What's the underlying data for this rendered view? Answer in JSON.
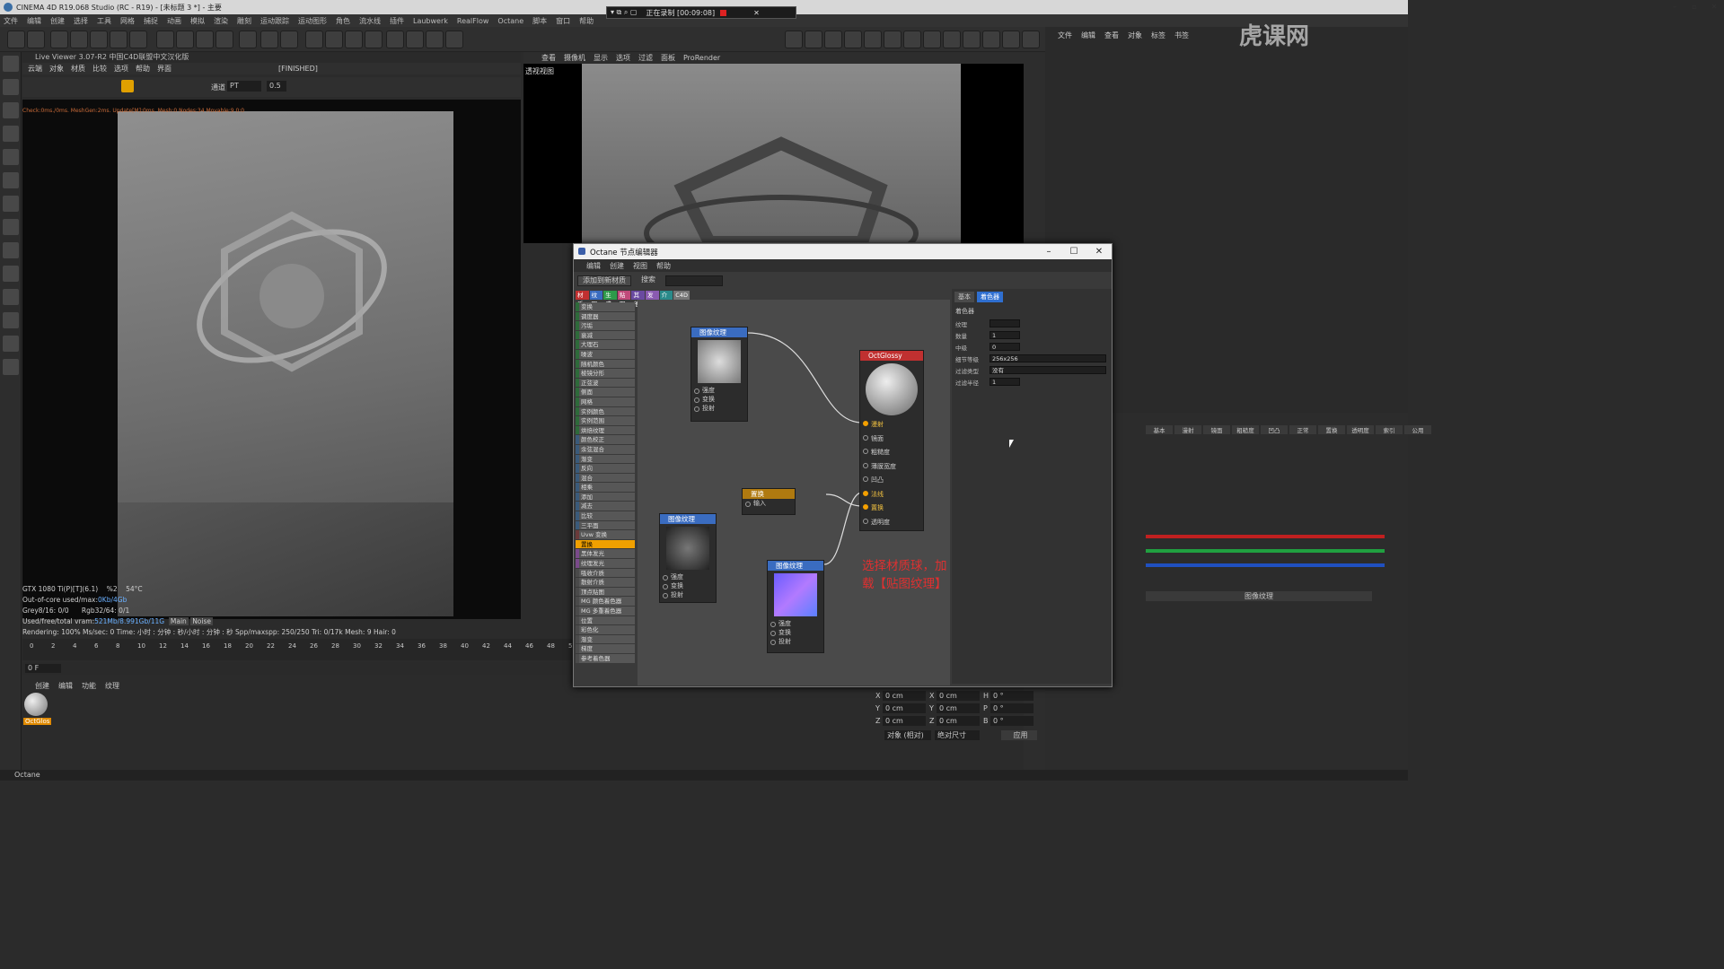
{
  "window": {
    "title": "CINEMA 4D R19.068 Studio (RC - R19) - [未标题 3 *] - 主要"
  },
  "menubar": [
    "文件",
    "编辑",
    "创建",
    "选择",
    "工具",
    "网格",
    "捕捉",
    "动画",
    "模拟",
    "渲染",
    "雕刻",
    "运动跟踪",
    "运动图形",
    "角色",
    "流水线",
    "插件",
    "Laubwerk",
    "RealFlow",
    "Octane",
    "脚本",
    "窗口",
    "帮助"
  ],
  "recorder": {
    "label": "正在录制 [00:09:08]"
  },
  "live_viewer": {
    "title": "Live Viewer 3.07-R2 中国C4D联盟中文汉化版",
    "menu": [
      "云端",
      "对象",
      "材质",
      "比较",
      "选项",
      "帮助",
      "界面"
    ],
    "state": "[FINISHED]",
    "channel_label": "通道",
    "channel_value": "PT",
    "channel_num": "0.5",
    "status_line": "Check:0ms./0ms. MeshGen:2ms. Update[M]:0ms. Mesh:0 Nodes:34 Movable:9  0:0",
    "stats": {
      "gpu": "GTX 1080 Ti(P)[T](6.1)",
      "gpu_pct": "%2",
      "gpu_temp": "54°C",
      "ooc": "Out-of-core used/max:",
      "ooc_val": "0Kb/4Gb",
      "grey": "Grey8/16: 0/0",
      "rgb": "Rgb32/64: 0/1",
      "vram": "Used/free/total vram:",
      "vram_val": "521Mb/8.991Gb/11G",
      "tab_main": "Main",
      "tab_noise": "Noise",
      "render_line": "Rendering: 100%   Ms/sec: 0   Time: 小时 : 分钟 : 秒/小时 : 分钟 : 秒   Spp/maxspp: 250/250   Tri: 0/17k   Mesh: 9   Hair: 0"
    }
  },
  "timeline": {
    "ticks": [
      "0",
      "2",
      "4",
      "6",
      "8",
      "10",
      "12",
      "14",
      "16",
      "18",
      "20",
      "22",
      "24",
      "26",
      "28",
      "30",
      "32",
      "34",
      "36",
      "38",
      "40",
      "42",
      "44",
      "46",
      "48",
      "50"
    ],
    "frame": "0 F"
  },
  "material_manager": {
    "menu": [
      "创建",
      "编辑",
      "功能",
      "纹理"
    ],
    "material_name": "OctGlos"
  },
  "viewport": {
    "menu": [
      "查看",
      "摄像机",
      "显示",
      "选项",
      "过滤",
      "面板",
      "ProRender"
    ],
    "label": "透视视图"
  },
  "object_manager": {
    "menu": [
      "文件",
      "编辑",
      "查看",
      "对象",
      "标签",
      "书签"
    ]
  },
  "octane_dialog": {
    "title": "Octane 节点编辑器",
    "menu": [
      "编辑",
      "创建",
      "视图",
      "帮助"
    ],
    "btn_add": "添加到新材质",
    "btn_search": "搜索",
    "tags": [
      {
        "label": "材质",
        "color": "#c03030"
      },
      {
        "label": "纹理",
        "color": "#3a6cc0"
      },
      {
        "label": "生成",
        "color": "#2e9a4a"
      },
      {
        "label": "贴图",
        "color": "#c04a7a"
      },
      {
        "label": "其他",
        "color": "#6a4aa0"
      },
      {
        "label": "发光",
        "color": "#8a5ab0"
      },
      {
        "label": "介质",
        "color": "#2a8a8a"
      },
      {
        "label": "C4D",
        "color": "#777777"
      }
    ],
    "node_list": [
      "变换",
      "调度器",
      "污垢",
      "衰减",
      "大理石",
      "噪波",
      "随机颜色",
      "棱镜分形",
      "正弦波",
      "侧面",
      "网格",
      "实例颜色",
      "实例范围",
      "烘焙纹理",
      "颜色校正",
      "余弦混合",
      "渐变",
      "反向",
      "混合",
      "相乘",
      "添加",
      "减去",
      "比较",
      "三平面",
      "Uvw 变换",
      "置换",
      "黑体发光",
      "纹理发光",
      "吸收介质",
      "散射介质",
      "顶点贴图",
      "MG 颜色着色器",
      "MG 多重着色器",
      "位置",
      "彩色化",
      "渐变",
      "梯度",
      "参考着色器"
    ],
    "selected_index": 25,
    "nodes": {
      "tex1": {
        "title": "图像纹理",
        "ports": [
          "强度",
          "变换",
          "投射"
        ]
      },
      "tex2": {
        "title": "图像纹理",
        "ports": [
          "强度",
          "变换",
          "投射"
        ]
      },
      "tex3": {
        "title": "图像纹理",
        "ports": [
          "强度",
          "变换",
          "投射"
        ]
      },
      "disp": {
        "title": "置换",
        "ports": [
          "输入"
        ]
      },
      "glossy": {
        "title": "OctGlossy",
        "ports": [
          "漫射",
          "镜面",
          "粗糙度",
          "薄膜宽度",
          "凹凸",
          "法线",
          "置换",
          "透明度"
        ]
      }
    },
    "annotation": "选择材质球，加载【贴图纹理】",
    "props": {
      "tabs": [
        "基本",
        "着色器"
      ],
      "section": "着色器",
      "rows": [
        {
          "label": "纹理",
          "value": ""
        },
        {
          "label": "数量",
          "value": "1"
        },
        {
          "label": "中级",
          "value": "0"
        },
        {
          "label": "细节等级",
          "value": "256x256"
        },
        {
          "label": "过滤类型",
          "value": "没有"
        },
        {
          "label": "过滤半径",
          "value": "1"
        }
      ]
    }
  },
  "coords": {
    "x_pos": "0 cm",
    "y_pos": "0 cm",
    "z_pos": "0 cm",
    "x_size": "0 cm",
    "y_size": "0 cm",
    "z_size": "0 cm",
    "h": "0 °",
    "p": "0 °",
    "b": "0 °",
    "mode1": "对象 (相对)",
    "mode2": "绝对尺寸",
    "apply": "应用"
  },
  "attr_tabs": [
    "基本",
    "漫射",
    "镜面",
    "粗糙度",
    "凹凸",
    "正常",
    "置换",
    "透明度",
    "索引",
    "公用"
  ],
  "attr_texture_label": "图像纹理",
  "statusbar": "Octane",
  "watermark": "虎课网"
}
